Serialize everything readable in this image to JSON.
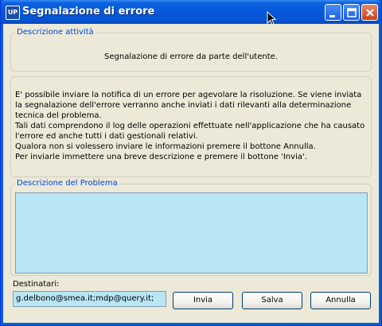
{
  "window": {
    "title": "Segnalazione di errore",
    "app_icon_text": "UP"
  },
  "activity_group": {
    "legend": "Descrizione attività",
    "text": "Segnalazione di errore da parte dell'utente."
  },
  "info": {
    "lines": [
      "E' possibile inviare la notifica di un errore per agevolare la risoluzione. Se viene inviata la segnalazione dell'errore verranno anche inviati i dati rilevanti alla determinazione tecnica del problema.",
      "Tali dati comprendono il log delle operazioni effettuate nell'applicazione che ha causato l'errore ed anche tutti i dati gestionali relativi.",
      "Qualora non si volessero inviare le informazioni premere il bottone Annulla.",
      "Per inviarle immettere una breve descrizione e premere il bottone 'Invia'."
    ]
  },
  "problem_group": {
    "legend": "Descrizione del Problema",
    "value": ""
  },
  "recipients": {
    "label": "Destinatari:",
    "value": "g.delbono@smea.it;mdp@query.it;"
  },
  "buttons": {
    "send": "Invia",
    "save": "Salva",
    "cancel": "Annulla"
  },
  "colors": {
    "titlebar": "#0758d8",
    "dialog_bg": "#ece9d8",
    "field_bg": "#b9e6f4",
    "legend_text": "#0046d5"
  },
  "icons": {
    "minimize": "minimize-icon",
    "maximize": "maximize-icon",
    "close": "close-icon"
  }
}
